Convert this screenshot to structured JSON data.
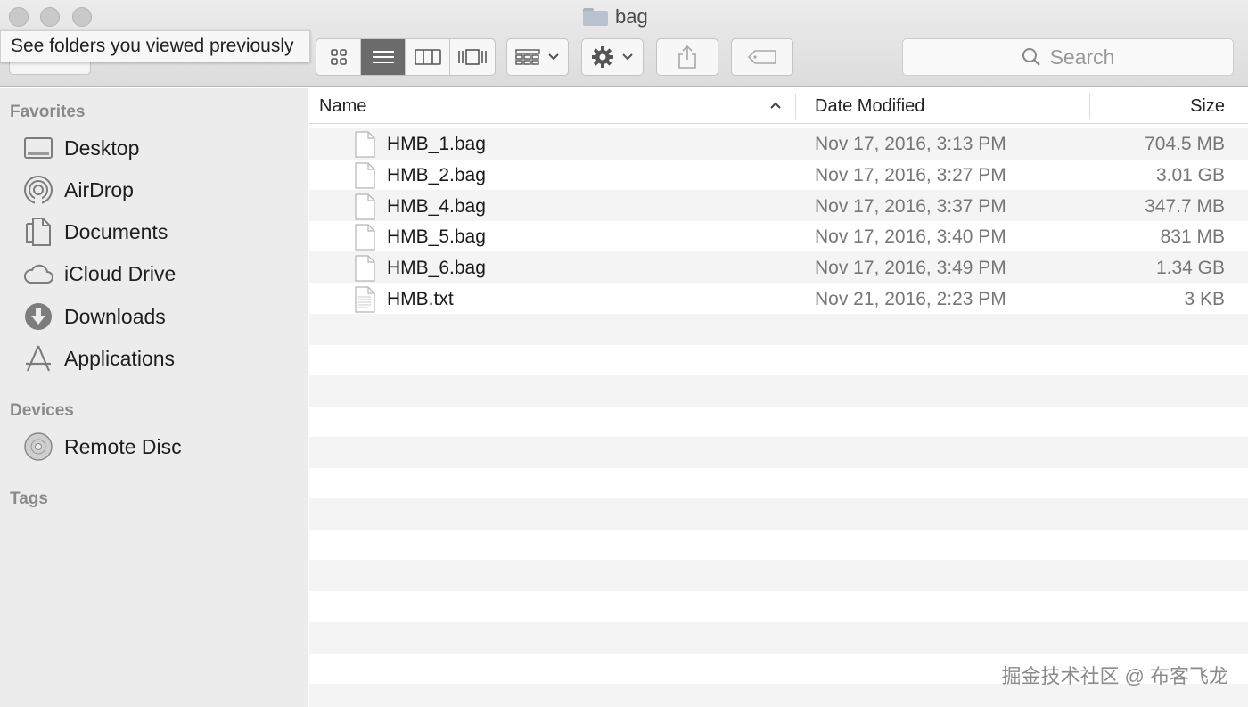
{
  "window": {
    "title": "bag"
  },
  "tooltip": {
    "text": "See folders you viewed previously"
  },
  "search": {
    "placeholder": "Search"
  },
  "sidebar": {
    "favorites_heading": "Favorites",
    "favorites": [
      {
        "label": "Desktop",
        "icon": "desktop-icon"
      },
      {
        "label": "AirDrop",
        "icon": "airdrop-icon"
      },
      {
        "label": "Documents",
        "icon": "documents-icon"
      },
      {
        "label": "iCloud Drive",
        "icon": "cloud-icon"
      },
      {
        "label": "Downloads",
        "icon": "download-icon"
      },
      {
        "label": "Applications",
        "icon": "applications-icon"
      }
    ],
    "devices_heading": "Devices",
    "devices": [
      {
        "label": "Remote Disc",
        "icon": "disc-icon"
      }
    ],
    "tags_heading": "Tags"
  },
  "list": {
    "columns": {
      "name": "Name",
      "date": "Date Modified",
      "size": "Size"
    },
    "files": [
      {
        "name": "HMB_1.bag",
        "date": "Nov 17, 2016, 3:13 PM",
        "size": "704.5 MB"
      },
      {
        "name": "HMB_2.bag",
        "date": "Nov 17, 2016, 3:27 PM",
        "size": "3.01 GB"
      },
      {
        "name": "HMB_4.bag",
        "date": "Nov 17, 2016, 3:37 PM",
        "size": "347.7 MB"
      },
      {
        "name": "HMB_5.bag",
        "date": "Nov 17, 2016, 3:40 PM",
        "size": "831 MB"
      },
      {
        "name": "HMB_6.bag",
        "date": "Nov 17, 2016, 3:49 PM",
        "size": "1.34 GB"
      },
      {
        "name": "HMB.txt",
        "date": "Nov 21, 2016, 2:23 PM",
        "size": "3 KB"
      }
    ]
  },
  "watermark": {
    "text": "掘金技术社区 @ 布客飞龙"
  }
}
